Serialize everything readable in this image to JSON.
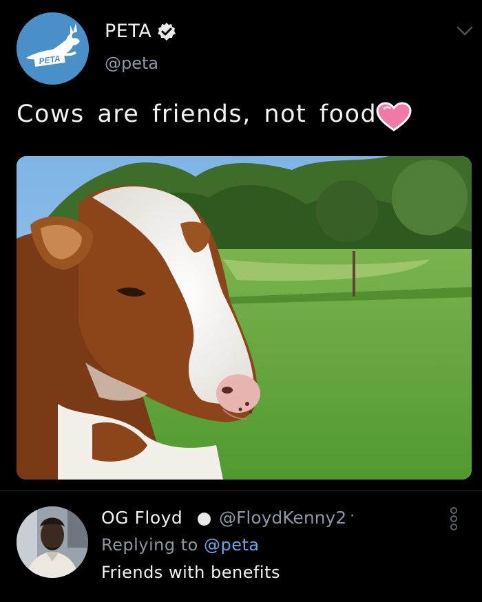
{
  "tweet": {
    "author": {
      "name": "PETA",
      "handle": "@peta",
      "logo_text": "PETA",
      "verified": true
    },
    "text": "Cows are friends, not food",
    "emoji": "heart-icon",
    "image": {
      "subject": "cow-photo"
    }
  },
  "reply": {
    "author": {
      "name": "OG Floyd",
      "handle": "@FloydKenny2",
      "separator": "·"
    },
    "replying_prefix": "Replying to",
    "replying_to": "@peta",
    "text": "Friends with benefits"
  },
  "icons": {
    "verified": "verified-badge-icon",
    "menu": "chevron-down-icon",
    "more": "more-vertical-icon"
  },
  "colors": {
    "background": "#000000",
    "peta_blue": "#4a90c8",
    "mention_blue": "#6aa6e8",
    "heart_pink": "#f27aa8"
  }
}
